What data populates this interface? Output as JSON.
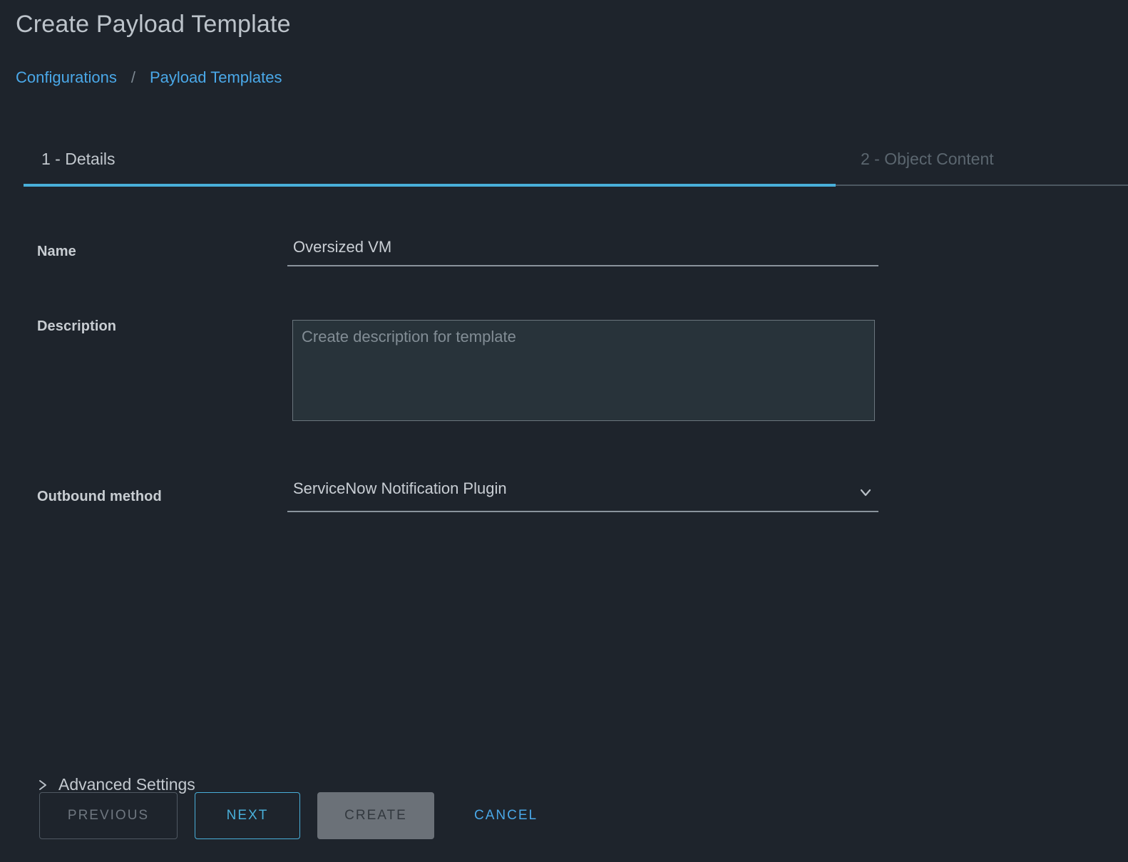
{
  "header": {
    "title": "Create Payload Template",
    "breadcrumb": {
      "items": [
        "Configurations",
        "Payload Templates"
      ],
      "separator": "/"
    }
  },
  "wizard": {
    "tabs": [
      {
        "label": "1 - Details",
        "state": "active"
      },
      {
        "label": "2 - Object Content",
        "state": "disabled"
      }
    ],
    "accent_color": "#49afd9"
  },
  "form": {
    "name": {
      "label": "Name",
      "value": "Oversized VM",
      "placeholder": ""
    },
    "description": {
      "label": "Description",
      "value": "",
      "placeholder": "Create description for template"
    },
    "outbound_method": {
      "label": "Outbound method",
      "value": "ServiceNow Notification Plugin",
      "icon": "chevron-down-icon"
    },
    "advanced_settings": {
      "label": "Advanced Settings",
      "icon": "chevron-right-icon",
      "expanded": false
    }
  },
  "footer": {
    "buttons": [
      {
        "label": "PREVIOUS",
        "state": "disabled"
      },
      {
        "label": "NEXT",
        "state": "primary"
      },
      {
        "label": "CREATE",
        "state": "disabled-filled"
      },
      {
        "label": "CANCEL",
        "state": "link"
      }
    ]
  }
}
